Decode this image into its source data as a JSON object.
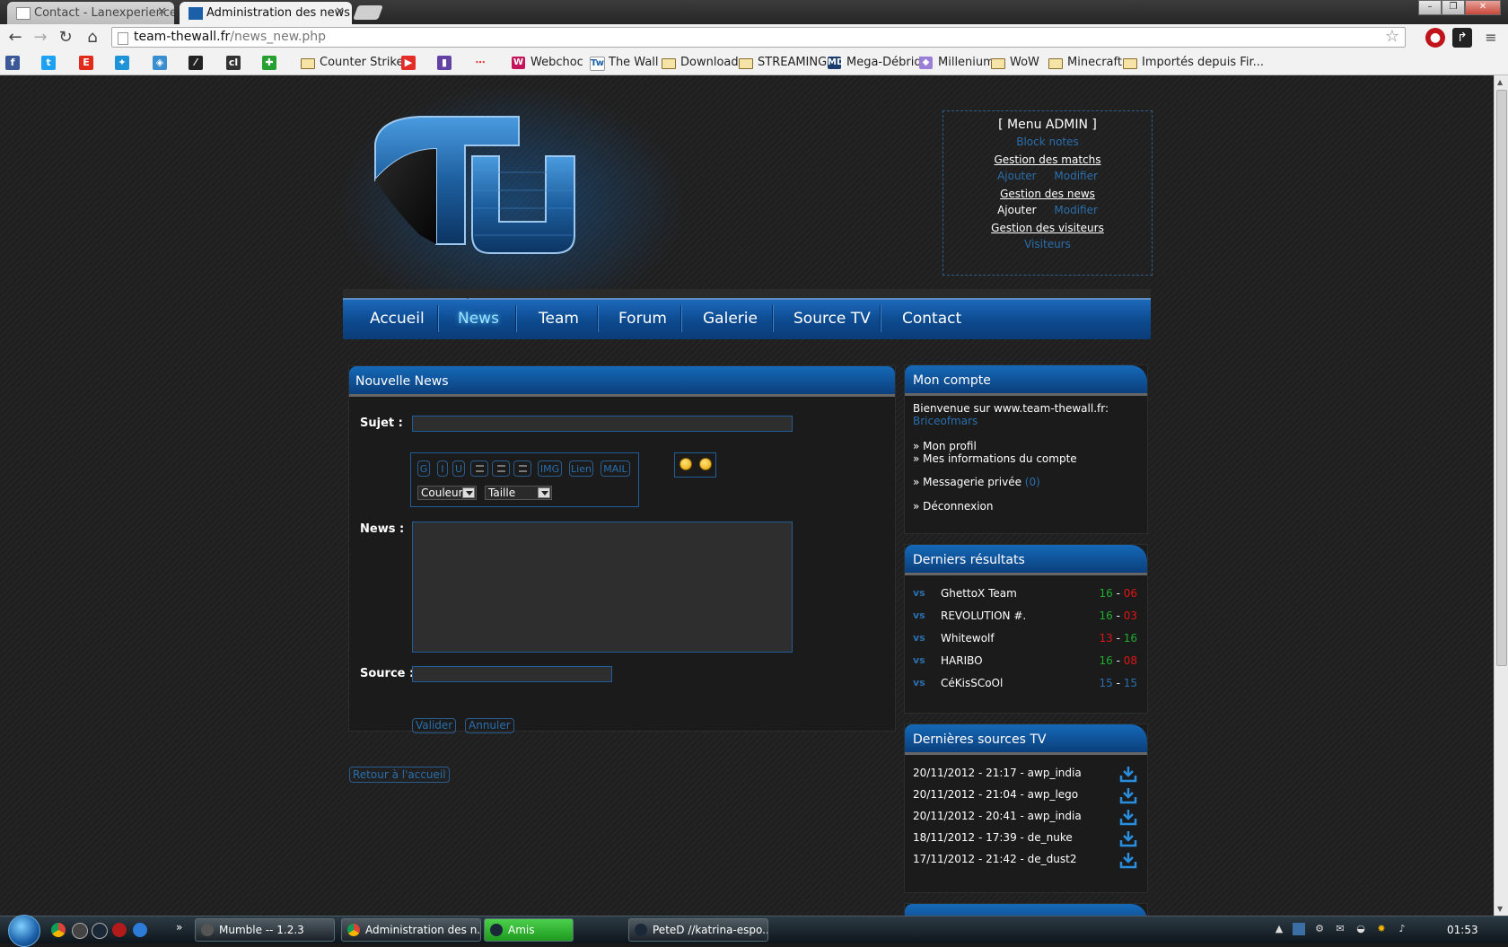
{
  "browser": {
    "tabs": [
      {
        "title": "Contact - Lanexperience",
        "active": false
      },
      {
        "title": "Administration des news",
        "active": true
      }
    ],
    "url_host": "team-thewall.fr",
    "url_path": "/news_new.php",
    "bookmarks": [
      {
        "label": "Counter Strike",
        "type": "folder"
      },
      {
        "label": "Webchoc",
        "type": "site"
      },
      {
        "label": "The Wall",
        "type": "site"
      },
      {
        "label": "Download",
        "type": "folder"
      },
      {
        "label": "STREAMING",
        "type": "folder"
      },
      {
        "label": "Mega-Débrid",
        "type": "site"
      },
      {
        "label": "Millenium",
        "type": "site"
      },
      {
        "label": "WoW",
        "type": "folder"
      },
      {
        "label": "Minecraft",
        "type": "folder"
      },
      {
        "label": "Importés depuis Fir...",
        "type": "folder"
      }
    ]
  },
  "admin_menu": {
    "title": "[ Menu ADMIN ]",
    "block_notes": "Block notes",
    "matches_title": "Gestion des matchs",
    "matches_add": "Ajouter",
    "matches_edit": "Modifier",
    "news_title": "Gestion des news",
    "news_add": "Ajouter",
    "news_edit": "Modifier",
    "visitors_title": "Gestion des visiteurs",
    "visitors_link": "Visiteurs"
  },
  "nav": {
    "items": [
      "Accueil",
      "News",
      "Team",
      "Forum",
      "Galerie",
      "Source TV",
      "Contact"
    ],
    "current": "News"
  },
  "news_form": {
    "title": "Nouvelle News",
    "subject_label": "Sujet :",
    "subject_value": "",
    "news_label": "News :",
    "news_value": "",
    "source_label": "Source :",
    "source_value": "",
    "format_buttons": [
      "G",
      "I",
      "U",
      "IMG",
      "Lien",
      "MAIL"
    ],
    "color_select": "Couleur",
    "size_select": "Taille",
    "submit": "Valider",
    "cancel": "Annuler",
    "back": "Retour à l'accueil"
  },
  "account": {
    "title": "Mon compte",
    "welcome": "Bienvenue sur www.team-thewall.fr:",
    "username": "Briceofmars",
    "profile": "» Mon profil",
    "account_info": "» Mes informations du compte",
    "messages": "» Messagerie privée",
    "messages_count": "(0)",
    "logout": "» Déconnexion"
  },
  "results": {
    "title": "Derniers résultats",
    "rows": [
      {
        "vs": "vs",
        "team": "GhettoX Team",
        "us": "16",
        "them": "06",
        "outcome": "win"
      },
      {
        "vs": "vs",
        "team": "REVOLUTION #.",
        "us": "16",
        "them": "03",
        "outcome": "win"
      },
      {
        "vs": "vs",
        "team": "Whitewolf",
        "us": "13",
        "them": "16",
        "outcome": "loss"
      },
      {
        "vs": "vs",
        "team": "HARIBO",
        "us": "16",
        "them": "08",
        "outcome": "win"
      },
      {
        "vs": "vs",
        "team": "CéKisSCoOl",
        "us": "15",
        "them": "15",
        "outcome": "draw"
      }
    ]
  },
  "sourcetv": {
    "title": "Dernières sources TV",
    "rows": [
      "20/11/2012 - 21:17 - awp_india",
      "20/11/2012 - 21:04 - awp_lego",
      "20/11/2012 - 20:41 - awp_india",
      "18/11/2012 - 17:39 - de_nuke",
      "17/11/2012 - 21:42 - de_dust2"
    ]
  },
  "taskbar": {
    "tasks": [
      "Mumble -- 1.2.3",
      "Administration des n...",
      "Amis",
      "PeteD //katrina-espo..."
    ],
    "clock": "01:53"
  },
  "colors": {
    "accent_blue": "#1569b8",
    "link_blue": "#2a6fad",
    "win_green": "#1fae2f",
    "loss_red": "#e01515"
  }
}
